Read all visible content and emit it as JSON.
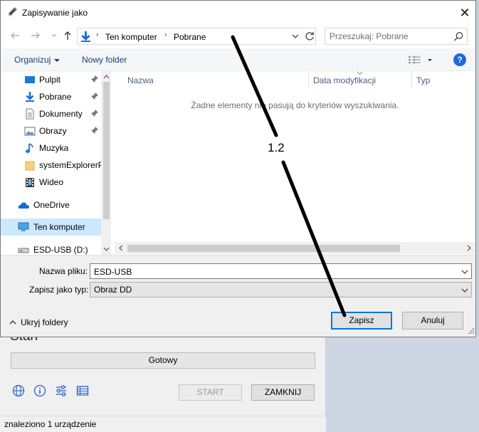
{
  "dialog": {
    "title": "Zapisywanie jako",
    "close_symbol": "✕"
  },
  "address": {
    "parts": [
      "Ten komputer",
      "Pobrane"
    ],
    "separator": "›"
  },
  "search": {
    "placeholder": "Przeszukaj: Pobrane"
  },
  "toolbar": {
    "organize_label": "Organizuj",
    "new_folder_label": "Nowy folder",
    "help_label": "?"
  },
  "sidebar": {
    "items": [
      {
        "label": "Pulpit",
        "icon": "desktop-icon",
        "pinned": true
      },
      {
        "label": "Pobrane",
        "icon": "download-icon",
        "pinned": true
      },
      {
        "label": "Dokumenty",
        "icon": "documents-icon",
        "pinned": true
      },
      {
        "label": "Obrazy",
        "icon": "pictures-icon",
        "pinned": true
      },
      {
        "label": "Muzyka",
        "icon": "music-icon",
        "pinned": false
      },
      {
        "label": "systemExplorerP",
        "icon": "folder-icon",
        "pinned": false
      },
      {
        "label": "Wideo",
        "icon": "video-icon",
        "pinned": false
      },
      {
        "label": "OneDrive",
        "icon": "onedrive-icon",
        "pinned": false
      },
      {
        "label": "Ten komputer",
        "icon": "computer-icon",
        "pinned": false
      },
      {
        "label": "ESD-USB (D:)",
        "icon": "usb-drive-icon",
        "pinned": false
      }
    ]
  },
  "file_list": {
    "columns": [
      "Nazwa",
      "Data modyfikacji",
      "Typ"
    ],
    "empty_message": "Żadne elementy nie pasują do kryteriów wyszukiwania."
  },
  "form": {
    "filename_label": "Nazwa pliku:",
    "filename_value": "ESD-USB",
    "filetype_label": "Zapisz jako typ:",
    "filetype_value": "Obraz DD",
    "hide_folders_label": "Ukryj foldery",
    "save_label": "Zapisz",
    "cancel_label": "Anuluj"
  },
  "background_app": {
    "heading_partial": "Stan",
    "status_text": "Gotowy",
    "start_label": "START",
    "close_label": "ZAMKNIJ",
    "statusbar_text": "znaleziono 1 urządzenie"
  },
  "annotation": {
    "label": "1.2"
  },
  "colors": {
    "accent": "#0078d7",
    "selection": "#cce8ff",
    "link": "#1a3e72"
  }
}
